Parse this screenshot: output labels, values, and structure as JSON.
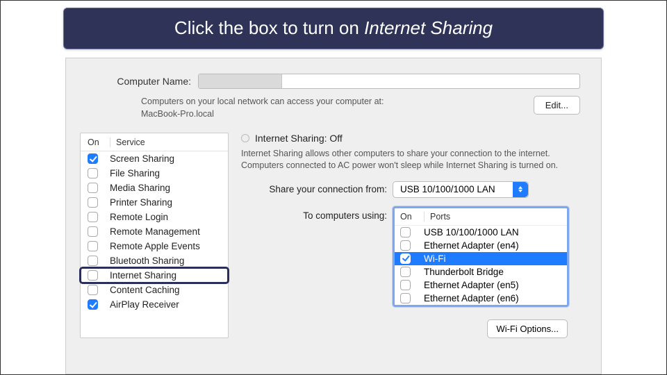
{
  "banner": {
    "prefix": "Click the box to turn on ",
    "italic": "Internet Sharing"
  },
  "computerName": {
    "label": "Computer Name:",
    "value": "",
    "helper_line1": "Computers on your local network can access your computer at:",
    "helper_line2": "MacBook-Pro.local",
    "editLabel": "Edit..."
  },
  "services": {
    "header_on": "On",
    "header_service": "Service",
    "items": [
      {
        "label": "Screen Sharing",
        "checked": true,
        "highlight": false
      },
      {
        "label": "File Sharing",
        "checked": false,
        "highlight": false
      },
      {
        "label": "Media Sharing",
        "checked": false,
        "highlight": false
      },
      {
        "label": "Printer Sharing",
        "checked": false,
        "highlight": false
      },
      {
        "label": "Remote Login",
        "checked": false,
        "highlight": false
      },
      {
        "label": "Remote Management",
        "checked": false,
        "highlight": false
      },
      {
        "label": "Remote Apple Events",
        "checked": false,
        "highlight": false
      },
      {
        "label": "Bluetooth Sharing",
        "checked": false,
        "highlight": false
      },
      {
        "label": "Internet Sharing",
        "checked": false,
        "highlight": true
      },
      {
        "label": "Content Caching",
        "checked": false,
        "highlight": false
      },
      {
        "label": "AirPlay Receiver",
        "checked": true,
        "highlight": false
      }
    ]
  },
  "details": {
    "status": "Internet Sharing: Off",
    "desc": "Internet Sharing allows other computers to share your connection to the internet. Computers connected to AC power won't sleep while Internet Sharing is turned on.",
    "shareFromLabel": "Share your connection from:",
    "shareFromValue": "USB 10/100/1000 LAN",
    "toLabel": "To computers using:",
    "ports_header_on": "On",
    "ports_header_ports": "Ports",
    "ports": [
      {
        "label": "USB 10/100/1000 LAN",
        "checked": false,
        "selected": false
      },
      {
        "label": "Ethernet Adapter (en4)",
        "checked": false,
        "selected": false
      },
      {
        "label": "Wi-Fi",
        "checked": true,
        "selected": true
      },
      {
        "label": "Thunderbolt Bridge",
        "checked": false,
        "selected": false
      },
      {
        "label": "Ethernet Adapter (en5)",
        "checked": false,
        "selected": false
      },
      {
        "label": "Ethernet Adapter (en6)",
        "checked": false,
        "selected": false
      }
    ],
    "wifiOptionsLabel": "Wi-Fi Options..."
  }
}
